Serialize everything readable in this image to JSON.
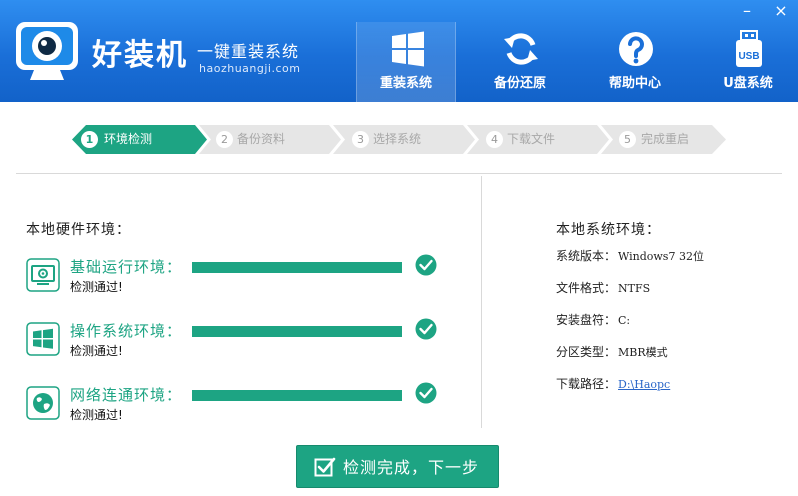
{
  "brand": {
    "name": "好装机",
    "slogan": "一键重装系统",
    "url": "haozhuangji.com",
    "color": "#1a6fd8"
  },
  "nav": [
    {
      "label": "重装系统",
      "icon": "windows-icon",
      "active": true
    },
    {
      "label": "备份还原",
      "icon": "refresh-icon",
      "active": false
    },
    {
      "label": "帮助中心",
      "icon": "help-icon",
      "active": false
    },
    {
      "label": "U盘系统",
      "icon": "usb-icon",
      "active": false
    }
  ],
  "window": {
    "minimize": "–",
    "close": "×"
  },
  "steps": [
    {
      "num": "1",
      "label": "环境检测",
      "active": true
    },
    {
      "num": "2",
      "label": "备份资料",
      "active": false
    },
    {
      "num": "3",
      "label": "选择系统",
      "active": false
    },
    {
      "num": "4",
      "label": "下载文件",
      "active": false
    },
    {
      "num": "5",
      "label": "完成重启",
      "active": false
    }
  ],
  "hardware": {
    "title": "本地硬件环境：",
    "checks": [
      {
        "label": "基础运行环境：",
        "status": "检测通过!",
        "icon": "monitor-gear-icon",
        "progress": 1.0
      },
      {
        "label": "操作系统环境：",
        "status": "检测通过!",
        "icon": "windows-icon",
        "progress": 1.0
      },
      {
        "label": "网络连通环境：",
        "status": "检测通过!",
        "icon": "globe-icon",
        "progress": 1.0
      }
    ]
  },
  "system": {
    "title": "本地系统环境：",
    "version_label": "系统版本：",
    "version_value": "Windows7  32位",
    "fs_label": "文件格式：",
    "fs_value": "NTFS",
    "drive_label": "安装盘符：",
    "drive_value": "C:",
    "partition_label": "分区类型：",
    "partition_value": "MBR模式",
    "path_label": "下载路径：",
    "path_value": "D:\\Haopc"
  },
  "next_button": {
    "label": "检测完成，下一步"
  },
  "colors": {
    "accent": "#1da483",
    "header": "#1a6fd8",
    "link": "#2a66c8"
  }
}
